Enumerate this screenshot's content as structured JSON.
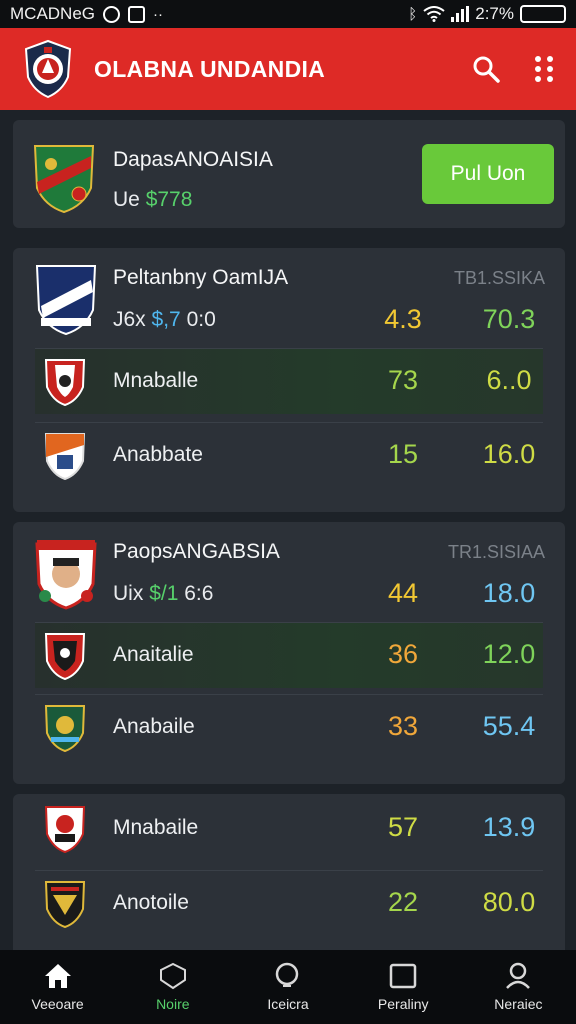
{
  "status": {
    "carrier": "MCADNeG",
    "battery": "2:7%"
  },
  "appbar": {
    "title": "OLABNA UNDANDIA",
    "logo_icon": "club-crest-icon",
    "search_icon": "search-icon",
    "menu_icon": "grid-dots-icon",
    "color": "#de2a26"
  },
  "featured": {
    "name": "DapasANOAISIA",
    "sub_prefix": "Ue",
    "sub_amount": "$778",
    "button_label": "Pul Uon"
  },
  "groups": [
    {
      "title": "Peltanbny OamIJA",
      "code": "TB1.SSIKA",
      "sub_prefix": "J6x",
      "sub_amount": "$,7",
      "sub_suffix": "0:0",
      "v1": "4.3",
      "v2": "70.3",
      "rows": [
        {
          "name": "Mnaballe",
          "v1": "73",
          "v2": "6..0"
        },
        {
          "name": "Anabbate",
          "v1": "15",
          "v2": "16.0"
        }
      ]
    },
    {
      "title": "PaopsANGABSIA",
      "code": "TR1.SISIAA",
      "sub_prefix": "Uix",
      "sub_amount": "$/1",
      "sub_suffix": "6:6",
      "v1": "44",
      "v2": "18.0",
      "rows": [
        {
          "name": "Anaitalie",
          "v1": "36",
          "v2": "12.0"
        },
        {
          "name": "Anabaile",
          "v1": "33",
          "v2": "55.4"
        }
      ]
    },
    {
      "rows": [
        {
          "name": "Mnabaile",
          "v1": "57",
          "v2": "13.9"
        },
        {
          "name": "Anotoile",
          "v1": "22",
          "v2": "80.0"
        }
      ]
    }
  ],
  "nav": [
    {
      "label": "Veeoare",
      "icon": "home-icon"
    },
    {
      "label": "Noire",
      "icon": "shield-icon"
    },
    {
      "label": "Iceicra",
      "icon": "search-icon"
    },
    {
      "label": "Peraliny",
      "icon": "square-icon"
    },
    {
      "label": "Neraiec",
      "icon": "profile-icon"
    }
  ]
}
